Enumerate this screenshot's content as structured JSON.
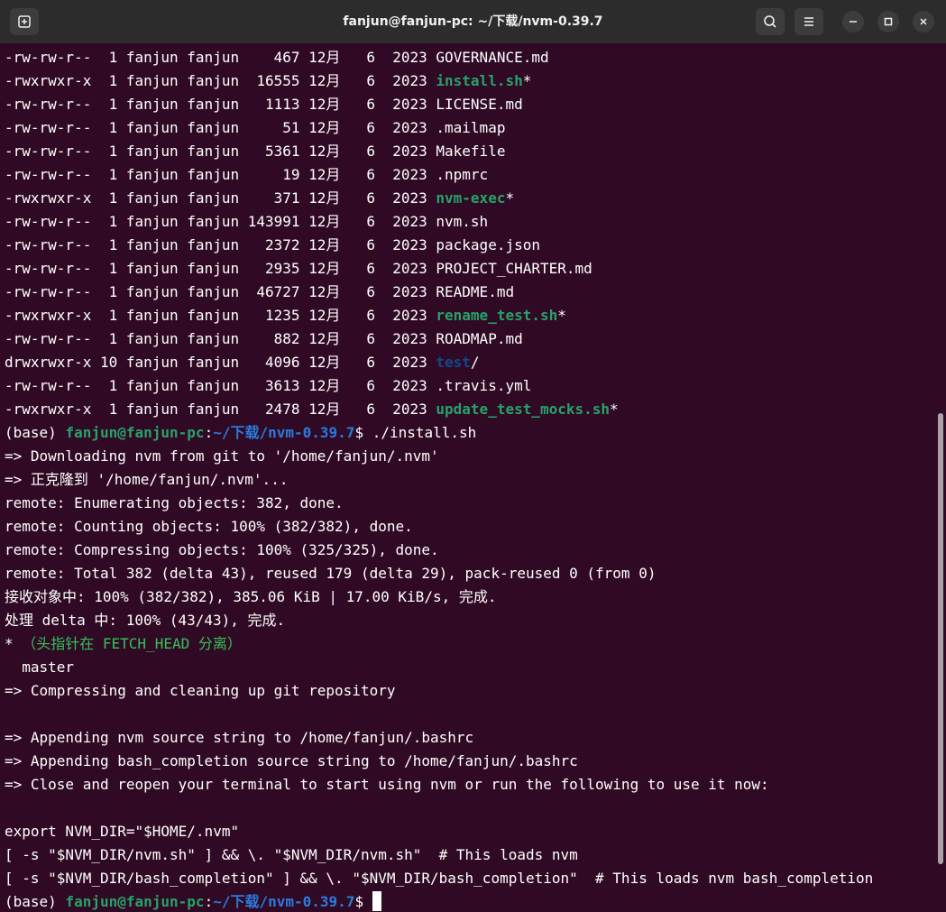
{
  "window": {
    "title": "fanjun@fanjun-pc: ~/下载/nvm-0.39.7"
  },
  "icons": {
    "new_tab": "new-tab-icon",
    "search": "search-icon",
    "menu": "hamburger-menu-icon",
    "minimize": "minimize-icon",
    "maximize": "maximize-icon",
    "close": "close-icon"
  },
  "colors": {
    "terminal_bg": "#300a24",
    "executable": "#26a269",
    "directory": "#12488b",
    "prompt_user": "#26a269",
    "prompt_path": "#2a7bde"
  },
  "listing": [
    {
      "perm": "-rw-rw-r--",
      "links": " 1",
      "user": "fanjun",
      "group": "fanjun",
      "size": "   467",
      "month": "12月",
      "day": " 6",
      "year": "2023",
      "name": "GOVERNANCE.md",
      "kind": "file"
    },
    {
      "perm": "-rwxrwxr-x",
      "links": " 1",
      "user": "fanjun",
      "group": "fanjun",
      "size": " 16555",
      "month": "12月",
      "day": " 6",
      "year": "2023",
      "name": "install.sh",
      "kind": "exec"
    },
    {
      "perm": "-rw-rw-r--",
      "links": " 1",
      "user": "fanjun",
      "group": "fanjun",
      "size": "  1113",
      "month": "12月",
      "day": " 6",
      "year": "2023",
      "name": "LICENSE.md",
      "kind": "file"
    },
    {
      "perm": "-rw-rw-r--",
      "links": " 1",
      "user": "fanjun",
      "group": "fanjun",
      "size": "    51",
      "month": "12月",
      "day": " 6",
      "year": "2023",
      "name": ".mailmap",
      "kind": "file"
    },
    {
      "perm": "-rw-rw-r--",
      "links": " 1",
      "user": "fanjun",
      "group": "fanjun",
      "size": "  5361",
      "month": "12月",
      "day": " 6",
      "year": "2023",
      "name": "Makefile",
      "kind": "file"
    },
    {
      "perm": "-rw-rw-r--",
      "links": " 1",
      "user": "fanjun",
      "group": "fanjun",
      "size": "    19",
      "month": "12月",
      "day": " 6",
      "year": "2023",
      "name": ".npmrc",
      "kind": "file"
    },
    {
      "perm": "-rwxrwxr-x",
      "links": " 1",
      "user": "fanjun",
      "group": "fanjun",
      "size": "   371",
      "month": "12月",
      "day": " 6",
      "year": "2023",
      "name": "nvm-exec",
      "kind": "exec"
    },
    {
      "perm": "-rw-rw-r--",
      "links": " 1",
      "user": "fanjun",
      "group": "fanjun",
      "size": "143991",
      "month": "12月",
      "day": " 6",
      "year": "2023",
      "name": "nvm.sh",
      "kind": "file"
    },
    {
      "perm": "-rw-rw-r--",
      "links": " 1",
      "user": "fanjun",
      "group": "fanjun",
      "size": "  2372",
      "month": "12月",
      "day": " 6",
      "year": "2023",
      "name": "package.json",
      "kind": "file"
    },
    {
      "perm": "-rw-rw-r--",
      "links": " 1",
      "user": "fanjun",
      "group": "fanjun",
      "size": "  2935",
      "month": "12月",
      "day": " 6",
      "year": "2023",
      "name": "PROJECT_CHARTER.md",
      "kind": "file"
    },
    {
      "perm": "-rw-rw-r--",
      "links": " 1",
      "user": "fanjun",
      "group": "fanjun",
      "size": " 46727",
      "month": "12月",
      "day": " 6",
      "year": "2023",
      "name": "README.md",
      "kind": "file"
    },
    {
      "perm": "-rwxrwxr-x",
      "links": " 1",
      "user": "fanjun",
      "group": "fanjun",
      "size": "  1235",
      "month": "12月",
      "day": " 6",
      "year": "2023",
      "name": "rename_test.sh",
      "kind": "exec"
    },
    {
      "perm": "-rw-rw-r--",
      "links": " 1",
      "user": "fanjun",
      "group": "fanjun",
      "size": "   882",
      "month": "12月",
      "day": " 6",
      "year": "2023",
      "name": "ROADMAP.md",
      "kind": "file"
    },
    {
      "perm": "drwxrwxr-x",
      "links": "10",
      "user": "fanjun",
      "group": "fanjun",
      "size": "  4096",
      "month": "12月",
      "day": " 6",
      "year": "2023",
      "name": "test",
      "kind": "dir"
    },
    {
      "perm": "-rw-rw-r--",
      "links": " 1",
      "user": "fanjun",
      "group": "fanjun",
      "size": "  3613",
      "month": "12月",
      "day": " 6",
      "year": "2023",
      "name": ".travis.yml",
      "kind": "file"
    },
    {
      "perm": "-rwxrwxr-x",
      "links": " 1",
      "user": "fanjun",
      "group": "fanjun",
      "size": "  2478",
      "month": "12月",
      "day": " 6",
      "year": "2023",
      "name": "update_test_mocks.sh",
      "kind": "exec"
    }
  ],
  "prompt": {
    "env": "(base) ",
    "user_host": "fanjun@fanjun-pc",
    "colon": ":",
    "path": "~/下载/nvm-0.39.7",
    "dollar": "$ "
  },
  "command": "./install.sh",
  "output": [
    "=> Downloading nvm from git to '/home/fanjun/.nvm'",
    "=> 正克隆到 '/home/fanjun/.nvm'...",
    "remote: Enumerating objects: 382, done.",
    "remote: Counting objects: 100% (382/382), done.",
    "remote: Compressing objects: 100% (325/325), done.",
    "remote: Total 382 (delta 43), reused 179 (delta 29), pack-reused 0 (from 0)",
    "接收对象中: 100% (382/382), 385.06 KiB | 17.00 KiB/s, 完成.",
    "处理 delta 中: 100% (43/43), 完成.",
    "* （头指针在 FETCH_HEAD 分离）",
    "  master",
    "=> Compressing and cleaning up git repository",
    "",
    "=> Appending nvm source string to /home/fanjun/.bashrc",
    "=> Appending bash_completion source string to /home/fanjun/.bashrc",
    "=> Close and reopen your terminal to start using nvm or run the following to use it now:",
    "",
    "export NVM_DIR=\"$HOME/.nvm\"",
    "[ -s \"$NVM_DIR/nvm.sh\" ] && \\. \"$NVM_DIR/nvm.sh\"  # This loads nvm",
    "[ -s \"$NVM_DIR/bash_completion\" ] && \\. \"$NVM_DIR/bash_completion\"  # This loads nvm bash_completion"
  ]
}
